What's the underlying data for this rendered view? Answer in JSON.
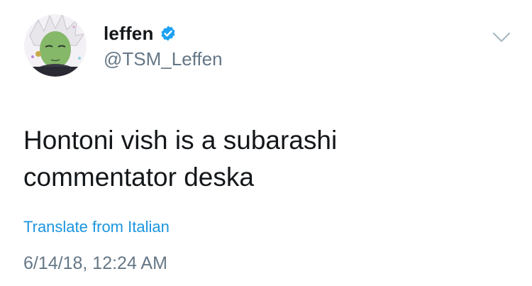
{
  "tweet": {
    "author": {
      "display_name": "leffen",
      "handle": "@TSM_Leffen",
      "verified": true,
      "avatar_icon": "anime-character-avatar"
    },
    "text_lines": [
      "Hontoni vish is a subarashi",
      "commentator deska"
    ],
    "translate_label": "Translate from Italian",
    "timestamp": "6/14/18, 12:24 AM",
    "menu_icon": "chevron-down-icon"
  },
  "colors": {
    "text": "#14171a",
    "secondary": "#657786",
    "link": "#1b95e0",
    "verified": "#1da1f2",
    "caret": "#aab8c2"
  }
}
